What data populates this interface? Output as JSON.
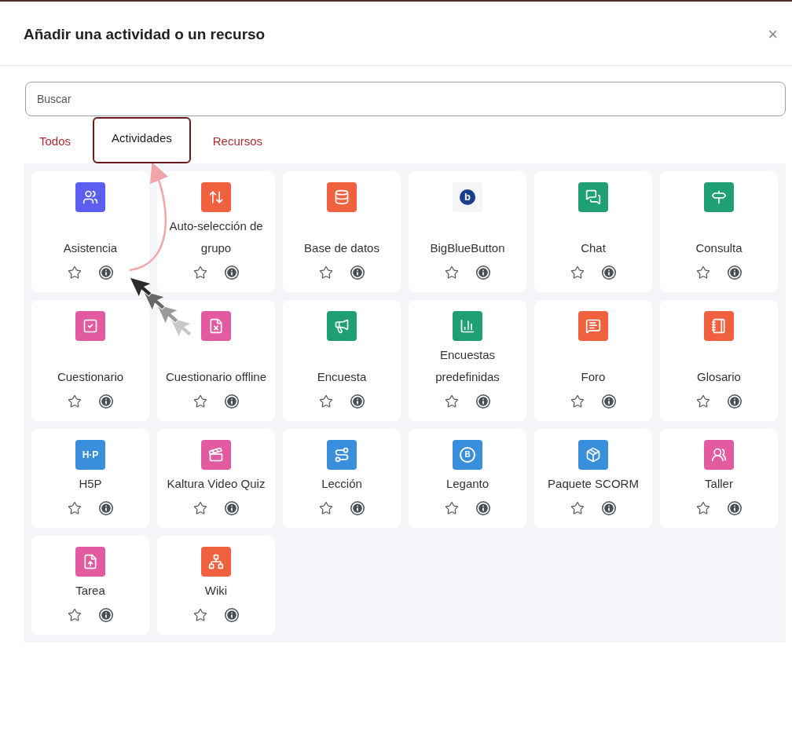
{
  "dialog": {
    "title": "Añadir una actividad o un recurso",
    "close": "×"
  },
  "search": {
    "placeholder": "Buscar"
  },
  "tabs": [
    {
      "label": "Todos",
      "selected": false
    },
    {
      "label": "Actividades",
      "selected": true
    },
    {
      "label": "Recursos",
      "selected": false
    }
  ],
  "items": [
    {
      "name": "Asistencia",
      "color": "#5b5ef0",
      "starred": false
    },
    {
      "name": "Auto-selección de grupo",
      "color": "#f0613f",
      "starred": false
    },
    {
      "name": "Base de datos",
      "color": "#f0613f",
      "starred": false
    },
    {
      "name": "BigBlueButton",
      "color": "#f4f5f7",
      "glyph": "b",
      "starred": false
    },
    {
      "name": "Chat",
      "color": "#1fa074",
      "starred": false
    },
    {
      "name": "Consulta",
      "color": "#1fa074",
      "starred": false
    },
    {
      "name": "Cuestionario",
      "color": "#e25ba0",
      "starred": false
    },
    {
      "name": "Cuestionario offline",
      "color": "#e25ba0",
      "starred": false
    },
    {
      "name": "Encuesta",
      "color": "#1fa074",
      "starred": false
    },
    {
      "name": "Encuestas predefinidas",
      "color": "#1fa074",
      "starred": false
    },
    {
      "name": "Foro",
      "color": "#f0613f",
      "starred": false
    },
    {
      "name": "Glosario",
      "color": "#f0613f",
      "starred": false
    },
    {
      "name": "H5P",
      "color": "#3a8fdc",
      "glyph": "H·P",
      "starred": false
    },
    {
      "name": "Kaltura Video Quiz",
      "color": "#e25ba0",
      "starred": false
    },
    {
      "name": "Lección",
      "color": "#3a8fdc",
      "starred": false
    },
    {
      "name": "Leganto",
      "color": "#3a8fdc",
      "glyph": "B",
      "starred": false
    },
    {
      "name": "Paquete SCORM",
      "color": "#3a8fdc",
      "starred": false
    },
    {
      "name": "Taller",
      "color": "#e25ba0",
      "starred": false
    },
    {
      "name": "Tarea",
      "color": "#e25ba0",
      "starred": false
    },
    {
      "name": "Wiki",
      "color": "#f0613f",
      "starred": false
    }
  ]
}
